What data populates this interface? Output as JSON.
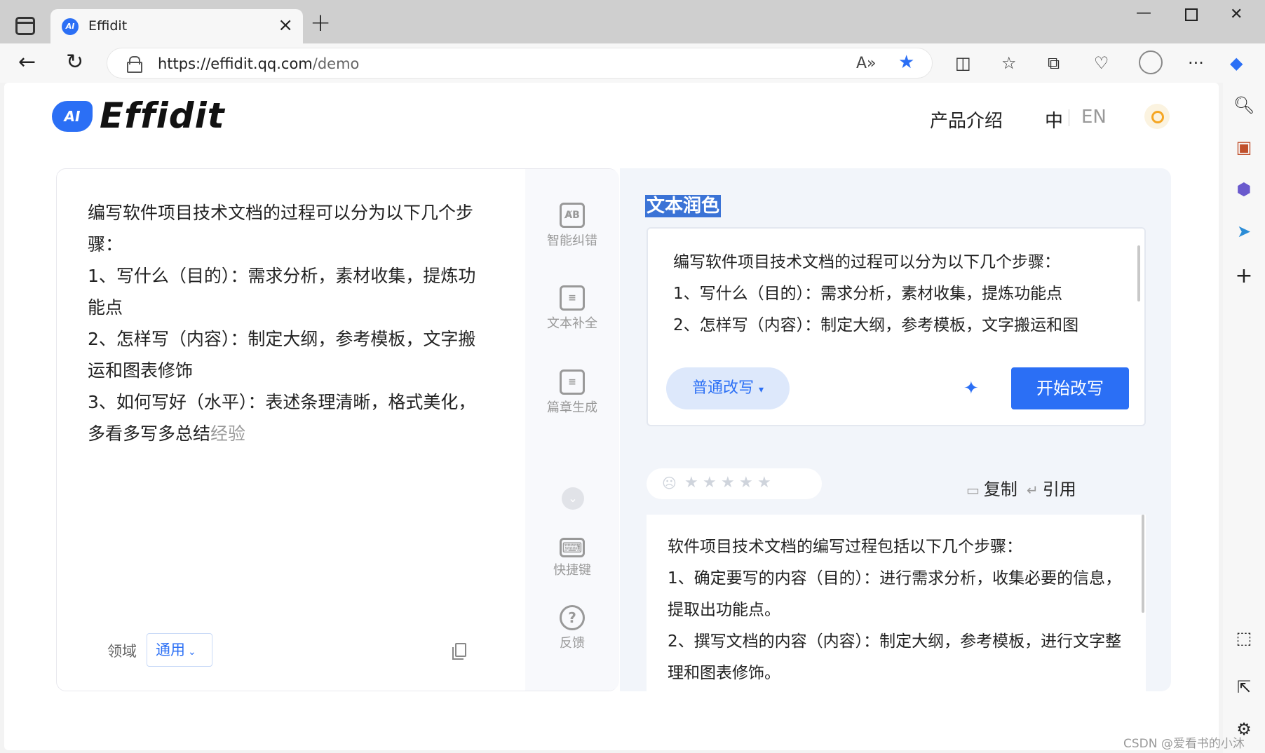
{
  "browser": {
    "tab_title": "Effidit",
    "url_host": "https://effidit.qq.com",
    "url_path": "/demo"
  },
  "header": {
    "logo_badge": "AI",
    "logo_text": "Effidit",
    "nav_product": "产品介绍",
    "lang_zh": "中",
    "lang_en": "EN"
  },
  "editor": {
    "lines": [
      "编写软件项目技术文档的过程可以分为以下几个步骤：",
      "1、写什么（目的）：需求分析，素材收集，提炼功能点",
      "2、怎样写（内容）：制定大纲，参考模板，文字搬运和图表修饰",
      "3、如何写好（水平）：表述条理清晰，格式美化，多看多写多总结"
    ],
    "ghost_text": "经验",
    "domain_label": "领域",
    "domain_value": "通用"
  },
  "tools": [
    {
      "label": "智能纠错",
      "icon": "ab-correct-icon",
      "glyph": "A̸B"
    },
    {
      "label": "文本补全",
      "icon": "document-complete-icon",
      "glyph": "≡"
    },
    {
      "label": "篇章生成",
      "icon": "document-generate-icon",
      "glyph": "≡"
    },
    {
      "label": "快捷键",
      "icon": "keyboard-icon",
      "glyph": "⌨"
    },
    {
      "label": "反馈",
      "icon": "help-icon",
      "glyph": "?"
    }
  ],
  "rewrite": {
    "title": "文本润色",
    "input_lines": [
      "编写软件项目技术文档的过程可以分为以下几个步骤：",
      "1、写什么（目的）：需求分析，素材收集，提炼功能点",
      "2、怎样写（内容）：制定大纲，参考模板，文字搬运和图"
    ],
    "mode_label": "普通改写",
    "start_label": "开始改写",
    "copy_label": "复制",
    "quote_label": "引用",
    "rating_stars": 5,
    "result_lines": [
      "软件项目技术文档的编写过程包括以下几个步骤：",
      "1、确定要写的内容（目的）：进行需求分析，收集必要的信息，提取出功能点。",
      "2、撰写文档的内容（内容）：制定大纲，参考模板，进行文字整理和图表修饰。"
    ]
  },
  "watermark": "CSDN @爱看书的小沐",
  "colors": {
    "accent": "#2b6ff5",
    "selection": "#3b73d6",
    "panel_bg": "#f2f5fa"
  }
}
